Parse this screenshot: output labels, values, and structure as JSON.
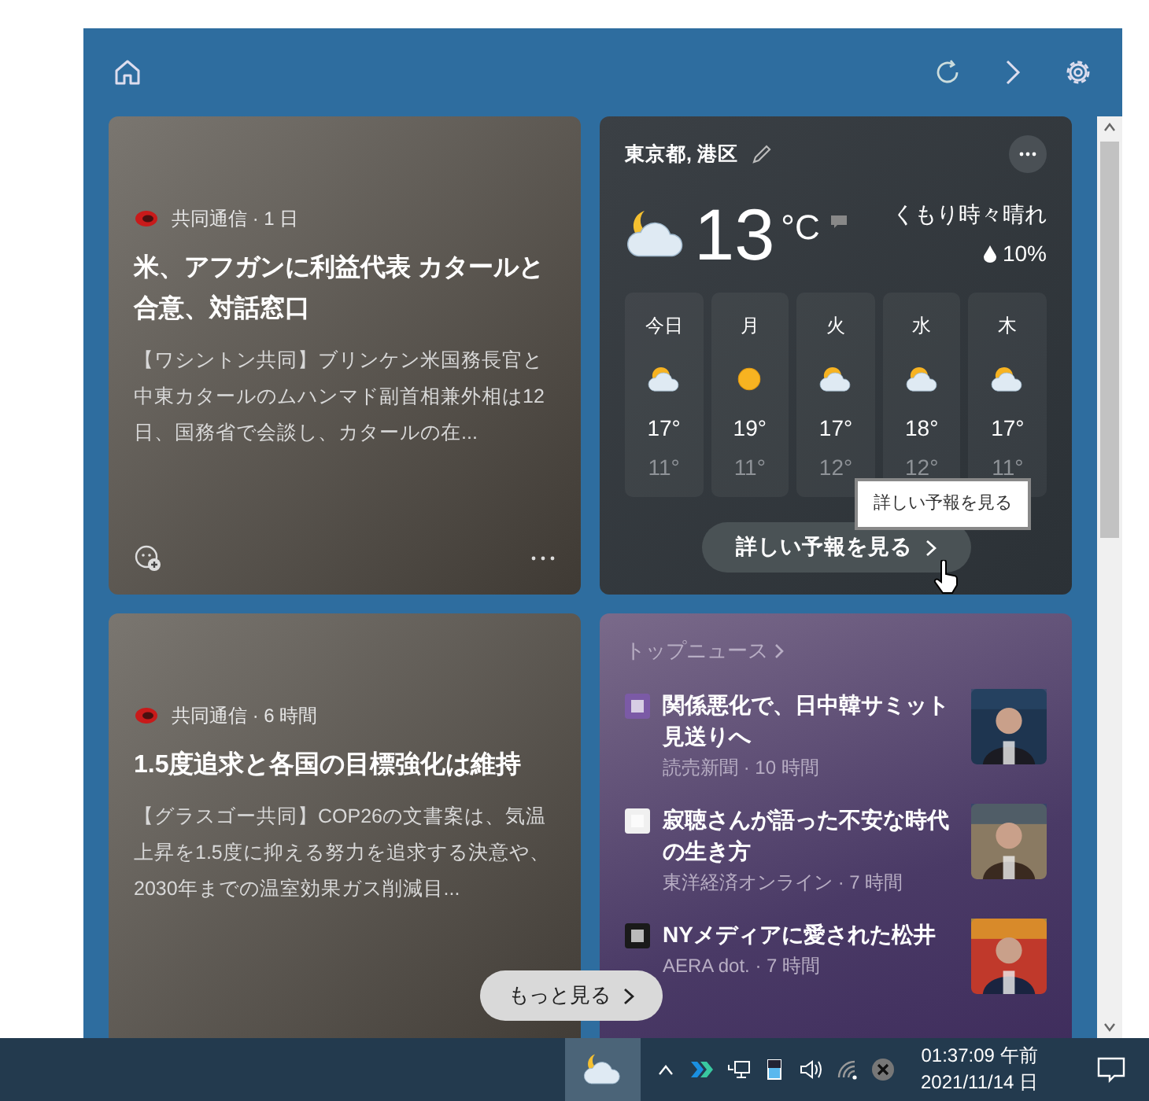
{
  "news_cards": [
    {
      "meta": "共同通信 · 1 日",
      "title": "米、アフガンに利益代表 カタールと合意、対話窓口",
      "summary": "【ワシントン共同】ブリンケン米国務長官と中東カタールのムハンマド副首相兼外相は12日、国務省で会談し、カタールの在...",
      "footer": true
    },
    {
      "meta": "共同通信 · 6 時間",
      "title": "1.5度追求と各国の目標強化は維持",
      "summary": "【グラスゴー共同】COP26の文書案は、気温上昇を1.5度に抑える努力を追求する決意や、2030年までの温室効果ガス削減目...",
      "footer": false
    }
  ],
  "weather": {
    "location": "東京都, 港区",
    "temperature": "13",
    "unit": "°C",
    "condition": "くもり時々晴れ",
    "precip": "10%",
    "kind": "moon_cloud",
    "forecast": [
      {
        "day": "今日",
        "kind": "sun_cloud",
        "high": "17°",
        "low": "11°"
      },
      {
        "day": "月",
        "kind": "sun",
        "high": "19°",
        "low": "11°"
      },
      {
        "day": "火",
        "kind": "sun_cloud",
        "high": "17°",
        "low": "12°"
      },
      {
        "day": "水",
        "kind": "sun_cloud",
        "high": "18°",
        "low": "12°"
      },
      {
        "day": "木",
        "kind": "sun_cloud",
        "high": "17°",
        "low": "11°"
      }
    ],
    "button": "詳しい予報を見る",
    "tooltip": "詳しい予報を見る"
  },
  "top_news": {
    "heading": "トップニュース",
    "items": [
      {
        "title": "関係悪化で、日中韓サミット見送りへ",
        "source": "読売新聞 · 10 時間",
        "color": "#7b5aa6"
      },
      {
        "title": "寂聴さんが語った不安な時代の生き方",
        "source": "東洋経済オンライン · 7 時間",
        "color": "#f0f0f0"
      },
      {
        "title": "NYメディアに愛された松井",
        "source": "AERA dot. · 7 時間",
        "color": "#1a1a1a"
      }
    ]
  },
  "more_button": "もっと見る",
  "taskbar": {
    "time": "01:37:09 午前",
    "date": "2021/11/14 日"
  }
}
